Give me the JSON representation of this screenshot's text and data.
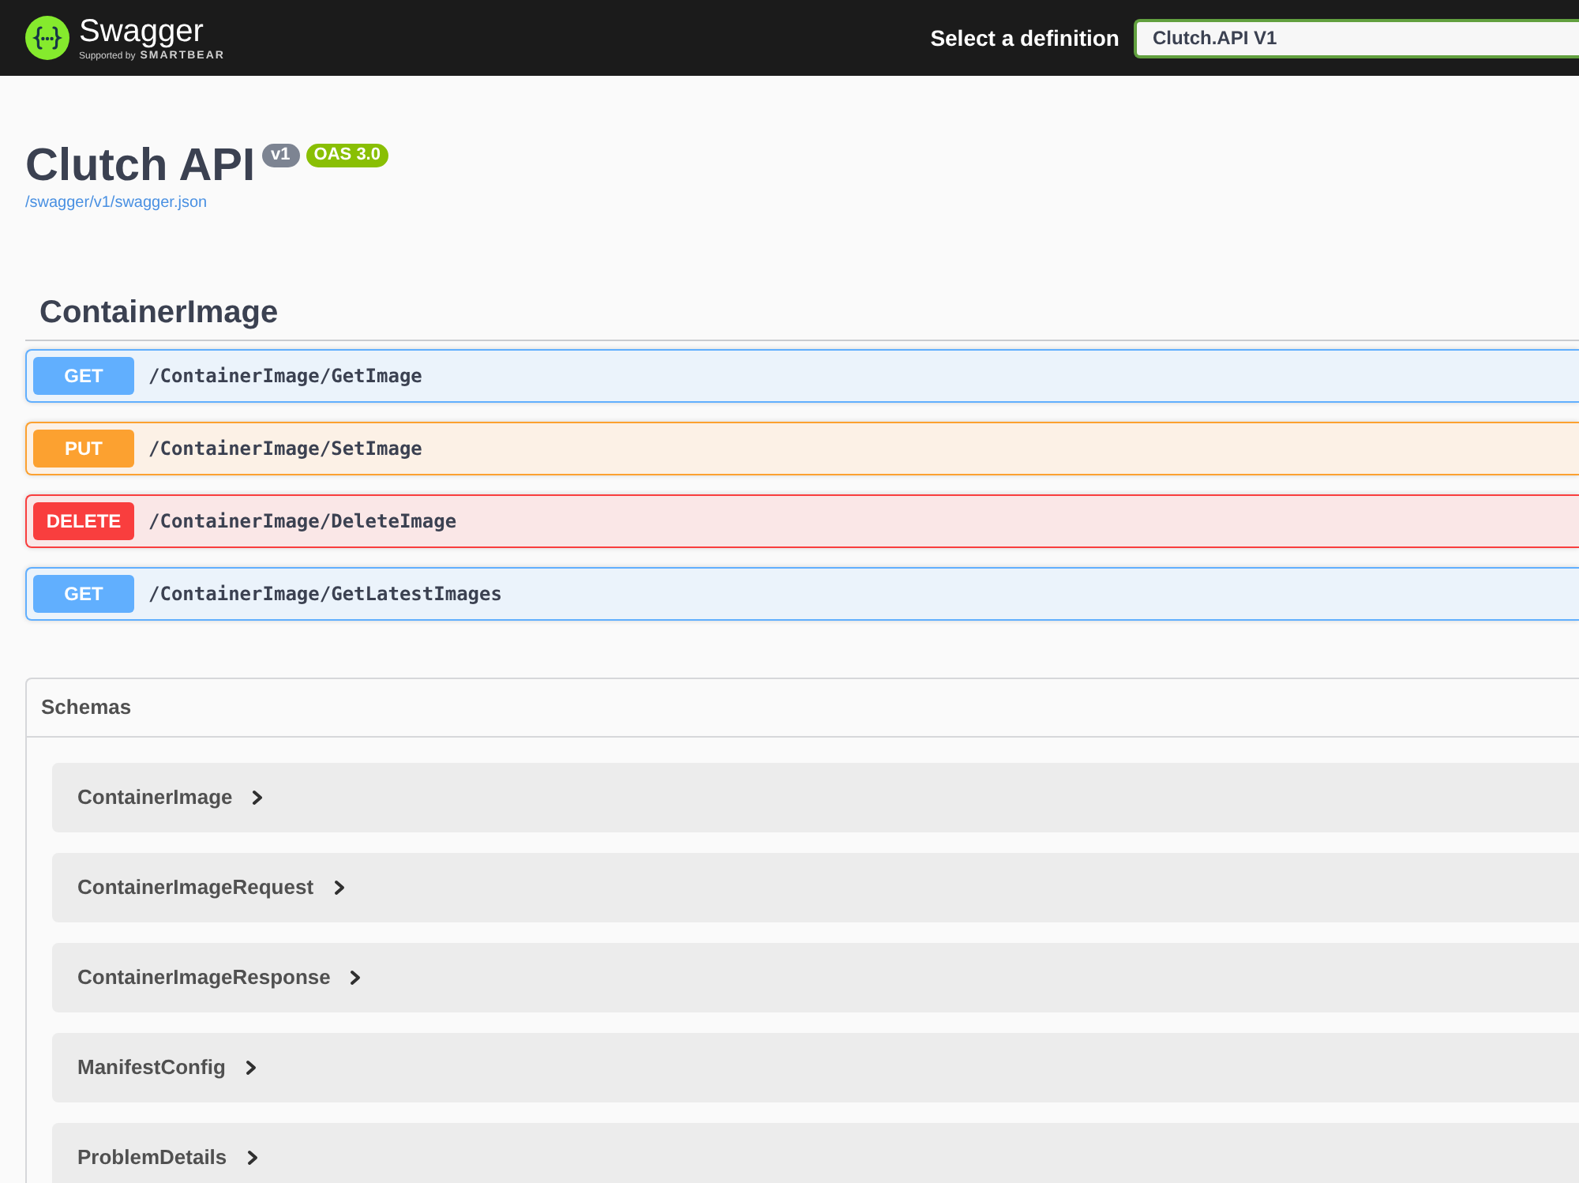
{
  "header": {
    "logo": {
      "name": "Swagger",
      "tagline": "Supported by",
      "brand": "SMARTBEAR"
    },
    "definition_select": {
      "label": "Select a definition",
      "value": "Clutch.API V1"
    }
  },
  "info": {
    "title": "Clutch API",
    "version": "v1",
    "spec_version": "OAS 3.0",
    "spec_url": "/swagger/v1/swagger.json"
  },
  "tag": {
    "name": "ContainerImage",
    "operations": [
      {
        "kind": "get",
        "method": "GET",
        "path": "/ContainerImage/GetImage"
      },
      {
        "kind": "put",
        "method": "PUT",
        "path": "/ContainerImage/SetImage"
      },
      {
        "kind": "delete",
        "method": "DELETE",
        "path": "/ContainerImage/DeleteImage"
      },
      {
        "kind": "get",
        "method": "GET",
        "path": "/ContainerImage/GetLatestImages"
      }
    ]
  },
  "schemas": {
    "title": "Schemas",
    "models": [
      {
        "name": "ContainerImage",
        "expanded": false
      },
      {
        "name": "ContainerImageRequest",
        "expanded": false
      },
      {
        "name": "ContainerImageResponse",
        "expanded": false
      },
      {
        "name": "ManifestConfig",
        "expanded": false
      },
      {
        "name": "ProblemDetails",
        "expanded": false
      }
    ]
  }
}
